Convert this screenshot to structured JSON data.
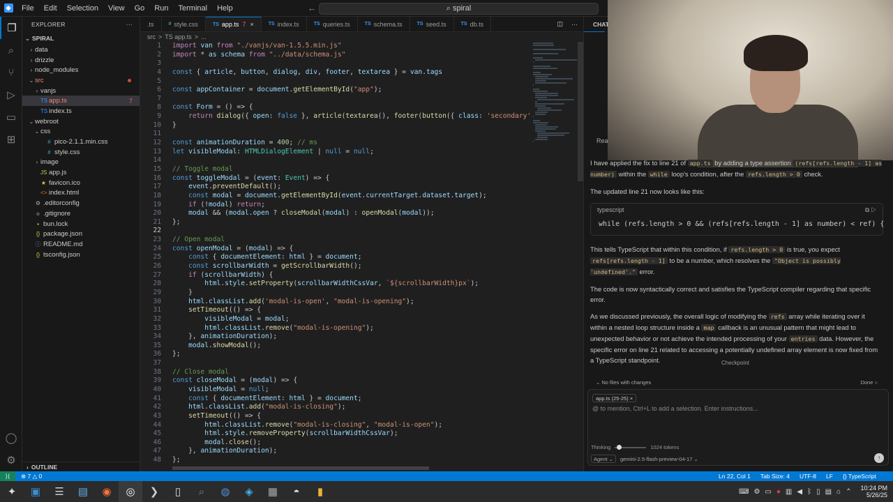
{
  "menu": [
    "File",
    "Edit",
    "Selection",
    "View",
    "Go",
    "Run",
    "Terminal",
    "Help"
  ],
  "command_center": "spiral",
  "explorer": {
    "title": "EXPLORER",
    "root": "SPIRAL",
    "items": [
      {
        "label": "data",
        "kind": "folder",
        "depth": 1,
        "open": false
      },
      {
        "label": "drizzle",
        "kind": "folder",
        "depth": 1,
        "open": false
      },
      {
        "label": "node_modules",
        "kind": "folder",
        "depth": 1,
        "open": false
      },
      {
        "label": "src",
        "kind": "folder",
        "depth": 1,
        "open": true,
        "red": true
      },
      {
        "label": "vanjs",
        "kind": "folder",
        "depth": 2,
        "open": false
      },
      {
        "label": "app.ts",
        "kind": "ts",
        "depth": 2,
        "selected": true,
        "red": true,
        "badge": "7"
      },
      {
        "label": "index.ts",
        "kind": "ts",
        "depth": 2
      },
      {
        "label": "webroot",
        "kind": "folder",
        "depth": 1,
        "open": true
      },
      {
        "label": "css",
        "kind": "folder",
        "depth": 2,
        "open": true
      },
      {
        "label": "pico-2.1.1.min.css",
        "kind": "css",
        "depth": 3
      },
      {
        "label": "style.css",
        "kind": "css",
        "depth": 3
      },
      {
        "label": "image",
        "kind": "folder",
        "depth": 2,
        "open": false
      },
      {
        "label": "app.js",
        "kind": "js",
        "depth": 2
      },
      {
        "label": "favicon.ico",
        "kind": "ico",
        "depth": 2
      },
      {
        "label": "index.html",
        "kind": "html",
        "depth": 2
      },
      {
        "label": ".editorconfig",
        "kind": "cfg",
        "depth": 1
      },
      {
        "label": ".gitignore",
        "kind": "git",
        "depth": 1
      },
      {
        "label": "bun.lock",
        "kind": "lock",
        "depth": 1
      },
      {
        "label": "package.json",
        "kind": "json",
        "depth": 1
      },
      {
        "label": "README.md",
        "kind": "md",
        "depth": 1
      },
      {
        "label": "tsconfig.json",
        "kind": "json",
        "depth": 1
      }
    ],
    "outline": "OUTLINE"
  },
  "tabs": [
    {
      "label": ".ts",
      "kind": "ts"
    },
    {
      "label": "style.css",
      "kind": "css"
    },
    {
      "label": "app.ts",
      "kind": "ts",
      "active": true,
      "modified": "7"
    },
    {
      "label": "index.ts",
      "kind": "ts"
    },
    {
      "label": "queries.ts",
      "kind": "ts"
    },
    {
      "label": "schema.ts",
      "kind": "ts"
    },
    {
      "label": "seed.ts",
      "kind": "ts"
    },
    {
      "label": "db.ts",
      "kind": "ts"
    }
  ],
  "breadcrumb": [
    "src",
    ">",
    "TS app.ts",
    ">",
    "..."
  ],
  "code_lines": [
    "import van from \"./vanjs/van-1.5.5.min.js\"",
    "import * as schema from \"../data/schema.js\"",
    "",
    "const { article, button, dialog, div, footer, textarea } = van.tags",
    "",
    "const appContainer = document.getElementById(\"app\");",
    "",
    "const Form = () => {",
    "    return dialog({ open: false }, article(textarea(), footer(button({ class: 'secondary' }",
    "}",
    "",
    "const animationDuration = 400; // ms",
    "let visibleModal: HTMLDialogElement | null = null;",
    "",
    "// Toggle modal",
    "const toggleModal = (event: Event) => {",
    "    event.preventDefault();",
    "    const modal = document.getElementById(event.currentTarget.dataset.target);",
    "    if (!modal) return;",
    "    modal && (modal.open ? closeModal(modal) : openModal(modal));",
    "};",
    "",
    "// Open modal",
    "const openModal = (modal) => {",
    "    const { documentElement: html } = document;",
    "    const scrollbarWidth = getScrollbarWidth();",
    "    if (scrollbarWidth) {",
    "        html.style.setProperty(scrollbarWidthCssVar, `${scrollbarWidth}px`);",
    "    }",
    "    html.classList.add('modal-is-open', \"modal-is-opening\");",
    "    setTimeout(() => {",
    "        visibleModal = modal;",
    "        html.classList.remove(\"modal-is-opening\");",
    "    }, animationDuration);",
    "    modal.showModal();",
    "};",
    "",
    "// Close modal",
    "const closeModal = (modal) => {",
    "    visibleModal = null;",
    "    const { documentElement: html } = document;",
    "    html.classList.add(\"modal-is-closing\");",
    "    setTimeout(() => {",
    "        html.classList.remove(\"modal-is-closing\", \"modal-is-open\");",
    "        html.style.removeProperty(scrollbarWidthCssVar);",
    "        modal.close();",
    "    }, animationDuration);",
    "};"
  ],
  "chat": {
    "title": "CHAT",
    "read_label": "Rea",
    "para1_a": "I have applied the fix to line 21 of ",
    "para1_file": "app.ts",
    "para1_b": " by adding a type assertion ",
    "para1_code": "(refs[refs.length - 1] as number)",
    "para1_c": " within the ",
    "para1_while": "while",
    "para1_d": " loop's condition, after the ",
    "para1_len": "refs.length > 0",
    "para1_e": " check.",
    "para2": "The updated line 21 now looks like this:",
    "code_lang": "typescript",
    "code_line": "while (refs.length > 0 && (refs[refs.length - 1] as number) < ref) {",
    "para3_a": "This tells TypeScript that within this condition, if ",
    "para3_c1": "refs.length > 0",
    "para3_b": " is true, you expect ",
    "para3_c2": "refs[refs.length - 1]",
    "para3_c": " to be a number, which resolves the ",
    "para3_c3": "\"Object is possibly 'undefined'.\"",
    "para3_d": " error.",
    "para4": "The code is now syntactically correct and satisfies the TypeScript compiler regarding that specific error.",
    "para5_a": "As we discussed previously, the overall logic of modifying the ",
    "para5_refs": "refs",
    "para5_b": " array while iterating over it within a nested loop structure inside a ",
    "para5_map": "map",
    "para5_c": " callback is an unusual pattern that might lead to unexpected behavior or not achieve the intended processing of your ",
    "para5_entries": "entries",
    "para5_d": " data. However, the specific error on line 21 related to accessing a potentially undefined array element is now fixed from a TypeScript standpoint.",
    "checkpoint": "Checkpoint",
    "no_files": "No files with changes",
    "done": "Done",
    "context_chip": "app.ts (25-25)",
    "placeholder": "@ to mention, Ctrl+L to add a selection. Enter instructions...",
    "thinking_label": "Thinking",
    "thinking_value": 0.05,
    "tokens": "1024 tokens",
    "mode": "Agent",
    "model": "gemini-2.5-flash-preview-04-17"
  },
  "status": {
    "problems": "7",
    "warnings": "0",
    "position": "Ln 22, Col 1",
    "tab_size": "Tab Size: 4",
    "encoding": "UTF-8",
    "eol": "LF",
    "language": "TypeScript"
  },
  "taskbar": {
    "time": "10:24 PM",
    "date": "5/26/25"
  },
  "colors": {
    "accent": "#0078d4",
    "status_bar": "#0078d4",
    "error": "#f48771"
  }
}
